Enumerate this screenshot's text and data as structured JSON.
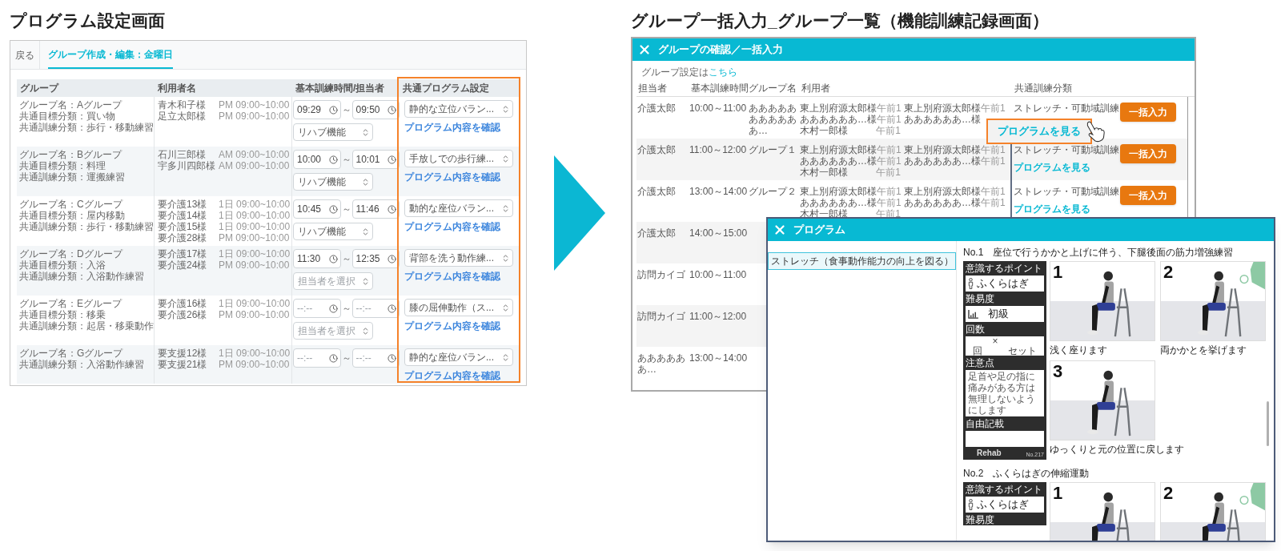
{
  "left_screen": {
    "title": "プログラム設定画面",
    "back": "戻る",
    "tabs": [
      {
        "label": "グループ作成・編集：金曜日",
        "selected": true
      }
    ],
    "columns": [
      "グループ",
      "利用者名",
      "基本訓練時間/担当者",
      "共通プログラム設定"
    ],
    "rows": [
      {
        "group_lines": [
          "グループ名：Aグループ",
          "共通目標分類：買い物",
          "共通訓練分類：歩行・移動練習"
        ],
        "users": [
          {
            "name": "青木和子様",
            "time": "PM 09:00~10:00"
          },
          {
            "name": "足立太郎様",
            "time": "PM 09:00~10:00"
          }
        ],
        "start": {
          "value": "09:29"
        },
        "separator": "～",
        "end": {
          "value": "09:50"
        },
        "staff": {
          "value": "リハブ機能"
        },
        "program": "静的な立位バラン...",
        "link": "プログラム内容を確認"
      },
      {
        "group_lines": [
          "グループ名：Bグループ",
          "共通目標分類：料理",
          "共通訓練分類：運搬練習"
        ],
        "users": [
          {
            "name": "石川三郎様",
            "time": "AM 09:00~10:00"
          },
          {
            "name": "宇多川四郎様",
            "time": "AM 09:00~10:00"
          }
        ],
        "start": {
          "value": "10:00"
        },
        "separator": "～",
        "end": {
          "value": "10:01"
        },
        "staff": {
          "value": "リハブ機能"
        },
        "program": "手放しでの歩行練...",
        "link": "プログラム内容を確認"
      },
      {
        "group_lines": [
          "グループ名：Cグループ",
          "共通目標分類：屋内移動",
          "共通訓練分類：歩行・移動練習"
        ],
        "users": [
          {
            "name": "要介護13様",
            "time": "1日 09:00~10:00"
          },
          {
            "name": "要介護14様",
            "time": "1日 09:00~10:00"
          },
          {
            "name": "要介護15様",
            "time": "1日 09:00~10:00"
          },
          {
            "name": "要介護28様",
            "time": "PM 09:00~10:00"
          }
        ],
        "start": {
          "value": "10:45"
        },
        "separator": "～",
        "end": {
          "value": "11:46"
        },
        "staff": {
          "value": "リハブ機能"
        },
        "program": "動的な座位バラン...",
        "link": "プログラム内容を確認"
      },
      {
        "group_lines": [
          "グループ名：Dグループ",
          "共通目標分類：入浴",
          "共通訓練分類：入浴動作練習"
        ],
        "users": [
          {
            "name": "要介護17様",
            "time": "1日 09:00~10:00"
          },
          {
            "name": "要介護24様",
            "time": "PM 09:00~10:00"
          }
        ],
        "start": {
          "value": "11:30"
        },
        "separator": "～",
        "end": {
          "value": "12:35"
        },
        "staff": {
          "placeholder": "担当者を選択"
        },
        "program": "背部を洗う動作練...",
        "link": "プログラム内容を確認"
      },
      {
        "group_lines": [
          "グループ名：Eグループ",
          "共通目標分類：移乗",
          "共通訓練分類：起居・移乗動作"
        ],
        "users": [
          {
            "name": "要介護16様",
            "time": "1日 09:00~10:00"
          },
          {
            "name": "要介護26様",
            "time": "PM 09:00~10:00"
          }
        ],
        "start": {
          "placeholder": "--:--"
        },
        "separator": "～",
        "end": {
          "placeholder": "--:--"
        },
        "staff": {
          "placeholder": "担当者を選択"
        },
        "program": "膝の屈伸動作（ス...",
        "link": "プログラム内容を確認"
      },
      {
        "group_lines": [
          "グループ名：Gグループ",
          "共通訓練分類：入浴動作練習"
        ],
        "users": [
          {
            "name": "要支援12様",
            "time": "1日 09:00~10:00"
          },
          {
            "name": "要支援21様",
            "time": "PM 09:00~10:00"
          }
        ],
        "start": {
          "placeholder": "--:--"
        },
        "separator": "～",
        "end": {
          "placeholder": "--:--"
        },
        "program": "静的な座位バラン...",
        "link": "プログラム内容を確認"
      }
    ]
  },
  "right_screen": {
    "title": "グループ一括入力_グループ一覧（機能訓練記録画面）",
    "window_title": "グループの確認／一括入力",
    "settings_note": {
      "text": "グループ設定は",
      "link": "こちら"
    },
    "columns": [
      "担当者",
      "基本訓練時間",
      "グループ名",
      "利用者",
      "共通訓練分類"
    ],
    "rows": [
      {
        "staff": "介護太郎",
        "time": "10:00～11:00",
        "group": "あああああああああああ…",
        "users": [
          [
            {
              "name": "東上別府源太郎様",
              "time": "午前1"
            },
            {
              "name": "ああああああ…様",
              "time": "午前1"
            },
            {
              "name": "木村一郎様",
              "time": "午前1"
            }
          ],
          [
            {
              "name": "東上別府源太郎様",
              "time": "午前1"
            },
            {
              "name": "ああああああ…様"
            }
          ]
        ],
        "category": "ストレッチ・可動域訓練",
        "button": "一括入力"
      },
      {
        "staff": "介護太郎",
        "time": "11:00～12:00",
        "group": "グループ１",
        "users": [
          [
            {
              "name": "東上別府源太郎様",
              "time": "午前1"
            },
            {
              "name": "ああああああ…様",
              "time": "午前1"
            },
            {
              "name": "木村一郎様",
              "time": "午前1"
            }
          ],
          [
            {
              "name": "東上別府源太郎様",
              "time": "午前1"
            },
            {
              "name": "ああああああ…様",
              "time": "午前1"
            }
          ]
        ],
        "category": "ストレッチ・可動域訓練",
        "link": "プログラムを見る",
        "button": "一括入力"
      },
      {
        "staff": "介護太郎",
        "time": "13:00～14:00",
        "group": "グループ２",
        "users": [
          [
            {
              "name": "東上別府源太郎様",
              "time": "午前1"
            },
            {
              "name": "ああああああ…様",
              "time": "午前1"
            },
            {
              "name": "木村一郎様",
              "time": "午前1"
            }
          ],
          [
            {
              "name": "東上別府源太郎様",
              "time": "午前1"
            },
            {
              "name": "ああああああ…様",
              "time": "午前1"
            }
          ]
        ],
        "category": "ストレッチ・可動域訓練",
        "link": "プログラムを見る",
        "button": "一括入力"
      },
      {
        "staff": "介護太郎",
        "time": "14:00～15:00"
      },
      {
        "staff": "訪問カイゴ",
        "time": "10:00～11:00"
      },
      {
        "staff": "訪問カイゴ",
        "time": "11:00～12:00"
      },
      {
        "staff": "ああああああ…",
        "time": "13:00～14:00"
      }
    ],
    "callout": "プログラムを見る"
  },
  "program_window": {
    "title": "プログラム",
    "sidebar": [
      {
        "label": "ストレッチ（食事動作能力の向上を図る）",
        "selected": true
      }
    ],
    "exercises": [
      {
        "heading": "No.1　座位で行うかかと上げに伴う、下腿後面の筋力増強練習",
        "panel": {
          "point_label": "意識するポイント",
          "point": "ふくらはぎ",
          "difficulty_label": "難易度",
          "difficulty": "初級",
          "count_label": "回数",
          "count_units": [
            "回",
            "×",
            "セット"
          ],
          "caution_label": "注意点",
          "caution": "足首や足の指に痛みがある方は無理しないようにします",
          "notes_label": "自由記載",
          "logo": "Rehab",
          "code": "No.217"
        },
        "steps": [
          {
            "number": "1",
            "caption": "浅く座ります",
            "exhale": false
          },
          {
            "number": "2",
            "caption": "両かかとを挙げます",
            "exhale": true
          },
          {
            "number": "3",
            "caption": "ゆっくりと元の位置に戻します",
            "exhale": false
          }
        ]
      },
      {
        "heading": "No.2　ふくらはぎの伸縮運動",
        "panel": {
          "point_label": "意識するポイント",
          "point": "ふくらはぎ",
          "difficulty_label": "難易度"
        },
        "steps": [
          {
            "number": "1",
            "exhale": false
          },
          {
            "number": "2",
            "exhale": true
          }
        ]
      }
    ]
  }
}
